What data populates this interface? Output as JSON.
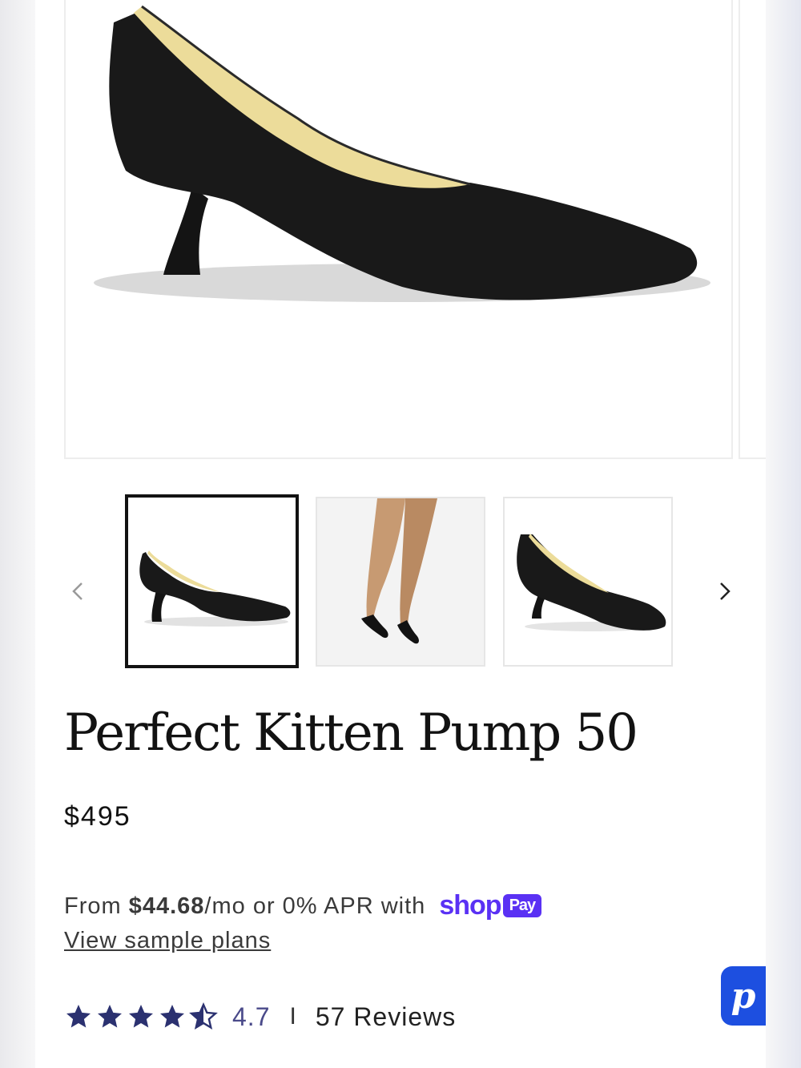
{
  "product": {
    "title": "Perfect Kitten Pump 50",
    "price": "$495"
  },
  "financing": {
    "prefix": "From ",
    "amount": "$44.68",
    "suffix": "/mo or 0% APR with",
    "brand_word": "shop",
    "brand_badge": "Pay",
    "link_label": "View sample plans",
    "brand_color": "#5a31f4"
  },
  "rating": {
    "value": "4.7",
    "separator": "I",
    "reviews_label": "57 Reviews",
    "stars_filled": 4.5,
    "star_color": "#2b3170"
  },
  "gallery": {
    "prev_icon": "chevron-left-icon",
    "next_icon": "chevron-right-icon",
    "thumbnails": [
      "side-view",
      "worn-on-legs",
      "three-quarter-view"
    ],
    "active_index": 0
  },
  "chat": {
    "icon": "chat-p-icon",
    "glyph": "p",
    "color": "#1d4fe0"
  }
}
